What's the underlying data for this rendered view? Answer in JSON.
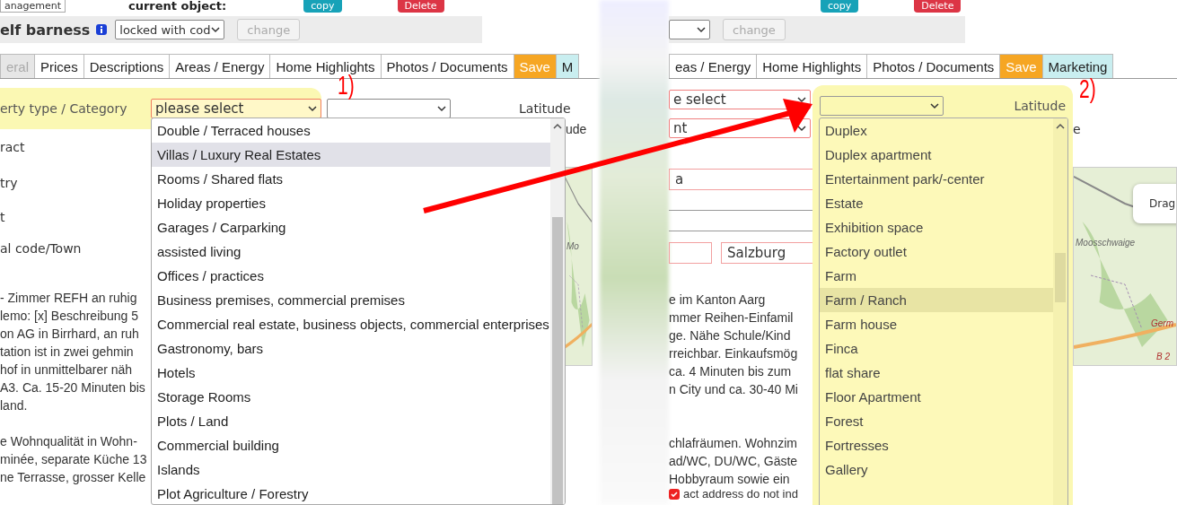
{
  "left": {
    "top_bar": {
      "management_button": "anagement",
      "current_object_label": "current object:",
      "copy_button": "copy",
      "delete_button": "Delete"
    },
    "lock_bar": {
      "name": "elf barness",
      "lock_select": "locked with cod",
      "change_button": "change"
    },
    "tabs": [
      {
        "label": "eral",
        "kind": "tab",
        "selected": true
      },
      {
        "label": "Prices",
        "kind": "tab",
        "selected": false
      },
      {
        "label": "Descriptions",
        "kind": "tab",
        "selected": false
      },
      {
        "label": "Areas / Energy",
        "kind": "tab",
        "selected": false
      },
      {
        "label": "Home Highlights",
        "kind": "tab",
        "selected": false
      },
      {
        "label": "Photos / Documents",
        "kind": "tab",
        "selected": false
      },
      {
        "label": "Save",
        "kind": "save",
        "selected": false
      },
      {
        "label": "M",
        "kind": "marketing",
        "selected": false
      }
    ],
    "annotation": "1)",
    "category_label": "erty type / Category",
    "category_select": "please select",
    "latitude_label": "Latitude",
    "longitude_label": "ude",
    "field_labels": [
      "ract",
      "try",
      "t",
      "al code/Town"
    ],
    "description_lines": [
      "- Zimmer REFH an ruhig",
      "lemo: [x] Beschreibung 5",
      "on AG in Birrhard, an ruh",
      "tation ist in zwei gehmin",
      "hof in unmittelbarer näh",
      "A3. Ca. 15-20 Minuten bis",
      "land."
    ],
    "description_lines_2": [
      "e Wohnqualität in Wohn-",
      "minée, separate Küche 13",
      "ne Terrasse, grosser Kelle"
    ],
    "map_labels": [
      "Mo"
    ],
    "dropdown": [
      {
        "label": "Double / Terraced houses",
        "selected": false
      },
      {
        "label": "Villas / Luxury Real Estates",
        "selected": true
      },
      {
        "label": "Rooms / Shared flats",
        "selected": false
      },
      {
        "label": "Holiday properties",
        "selected": false
      },
      {
        "label": "Garages / Carparking",
        "selected": false
      },
      {
        "label": "assisted living",
        "selected": false
      },
      {
        "label": "Offices / practices",
        "selected": false
      },
      {
        "label": "Business premises, commercial premises",
        "selected": false
      },
      {
        "label": "Commercial real estate, business objects, commercial enterprises",
        "selected": false
      },
      {
        "label": "Gastronomy, bars",
        "selected": false
      },
      {
        "label": "Hotels",
        "selected": false
      },
      {
        "label": "Storage Rooms",
        "selected": false
      },
      {
        "label": "Plots / Land",
        "selected": false
      },
      {
        "label": "Commercial building",
        "selected": false
      },
      {
        "label": "Islands",
        "selected": false
      },
      {
        "label": "Plot Agriculture / Forestry",
        "selected": false
      }
    ]
  },
  "right": {
    "top_bar": {
      "copy_button": "copy",
      "delete_button": "Delete"
    },
    "lock_bar": {
      "change_button": "change"
    },
    "tabs": [
      {
        "label": "eas / Energy",
        "kind": "tab",
        "selected": false
      },
      {
        "label": "Home Highlights",
        "kind": "tab",
        "selected": false
      },
      {
        "label": "Photos / Documents",
        "kind": "tab",
        "selected": false
      },
      {
        "label": "Save",
        "kind": "save",
        "selected": false
      },
      {
        "label": "Marketing",
        "kind": "marketing",
        "selected": false
      }
    ],
    "annotation": "2)",
    "category_select": "e select",
    "subtype_select": "nt",
    "latitude_label": "Latitude",
    "longitude_label": "e",
    "country_field": "a",
    "town_field": "Salzburg",
    "description_lines": [
      "e im Kanton Aarg",
      "mmer Reihen-Einfamil",
      "ge. Nähe Schule/Kind",
      "rreichbar. Einkaufsmög",
      "ca. 4 Minuten bis zum",
      "n City und ca. 30-40 Mi"
    ],
    "description_lines_2": [
      "chlafräumen. Wohnzim",
      "ad/WC, DU/WC, Gäste",
      "Hobbyraum sowie ein"
    ],
    "address_note": "act address do not ind",
    "address_checked": true,
    "map_labels": [
      "Moosschwaige",
      "Germ",
      "B 2"
    ],
    "map_tooltip": "Drag",
    "dropdown": [
      {
        "label": "Duplex",
        "selected": false
      },
      {
        "label": "Duplex apartment",
        "selected": false
      },
      {
        "label": "Entertainment park/-center",
        "selected": false
      },
      {
        "label": "Estate",
        "selected": false
      },
      {
        "label": "Exhibition space",
        "selected": false
      },
      {
        "label": "Factory outlet",
        "selected": false
      },
      {
        "label": "Farm",
        "selected": false
      },
      {
        "label": "Farm / Ranch",
        "selected": true
      },
      {
        "label": "Farm house",
        "selected": false
      },
      {
        "label": "Finca",
        "selected": false
      },
      {
        "label": "flat share",
        "selected": false
      },
      {
        "label": "Floor Apartment",
        "selected": false
      },
      {
        "label": "Forest",
        "selected": false
      },
      {
        "label": "Fortresses",
        "selected": false
      },
      {
        "label": "Gallery",
        "selected": false
      }
    ]
  }
}
